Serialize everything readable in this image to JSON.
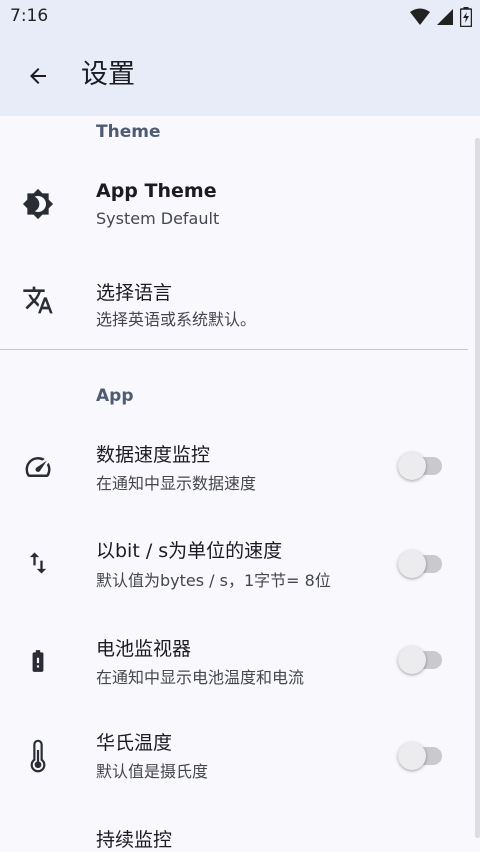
{
  "status_bar": {
    "time": "7:16",
    "icons": [
      "wifi-icon",
      "signal-icon",
      "battery-icon"
    ]
  },
  "app_bar": {
    "title": "设置",
    "back_icon": "arrow-back-icon"
  },
  "sections": {
    "theme": {
      "header": "Theme"
    },
    "app": {
      "header": "App"
    }
  },
  "items": {
    "app_theme": {
      "title": "App Theme",
      "subtitle": "System Default",
      "icon": "brightness-icon"
    },
    "language": {
      "title": "选择语言",
      "subtitle": "选择英语或系统默认。",
      "icon": "translate-icon"
    },
    "data_speed": {
      "title": "数据速度监控",
      "subtitle": "在通知中显示数据速度",
      "icon": "speedometer-icon",
      "enabled": false
    },
    "bits_speed": {
      "title": "以bit / s为单位的速度",
      "subtitle": "默认值为bytes / s，1字节= 8位",
      "icon": "swap-vert-icon",
      "enabled": false
    },
    "battery": {
      "title": " 电池监视器",
      "subtitle": "在通知中显示电池温度和电流",
      "icon": "battery-alert-icon",
      "enabled": false
    },
    "fahrenheit": {
      "title": "华氏温度",
      "subtitle": "默认值是摄氏度",
      "icon": "thermometer-icon",
      "enabled": false
    },
    "continuous": {
      "title": "持续监控"
    }
  },
  "colors": {
    "app_bar_bg": "#e7ecf8",
    "page_bg": "#f8f8fd",
    "section_header": "#4f5b72"
  }
}
